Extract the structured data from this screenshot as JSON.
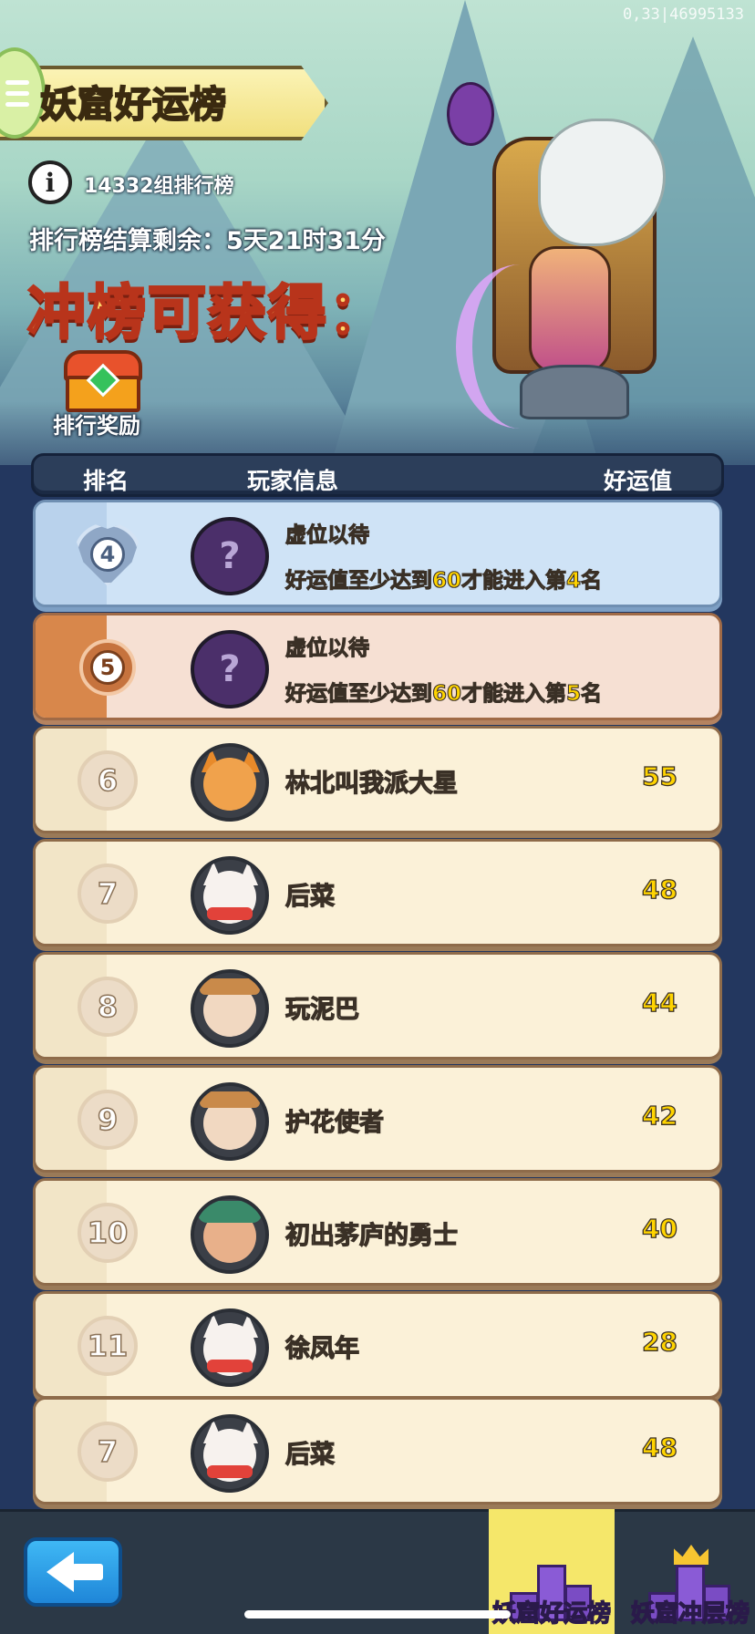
{
  "debug_id": "0,33|46995133",
  "header": {
    "title": "妖窟好运榜",
    "group_info": "14332组排行榜",
    "countdown": "排行榜结算剩余：5天21时31分",
    "reward_headline": "冲榜可获得：",
    "reward_label": "排行奖励"
  },
  "table": {
    "columns": [
      "排名",
      "玩家信息",
      "好运值"
    ],
    "placeholder_rows": [
      {
        "rank": "4",
        "name": "虚位以待",
        "hint_prefix": "好运值至少达到",
        "hint_score": "60",
        "hint_mid": "才能进入第",
        "hint_rank": "4",
        "hint_suffix": "名"
      },
      {
        "rank": "5",
        "name": "虚位以待",
        "hint_prefix": "好运值至少达到",
        "hint_score": "60",
        "hint_mid": "才能进入第",
        "hint_rank": "5",
        "hint_suffix": "名"
      }
    ],
    "rows": [
      {
        "rank": "6",
        "name": "林北叫我派大星",
        "score": "55",
        "avatar": "corgi"
      },
      {
        "rank": "7",
        "name": "后菜",
        "score": "48",
        "avatar": "lucky-cat"
      },
      {
        "rank": "8",
        "name": "玩泥巴",
        "score": "44",
        "avatar": "warrior"
      },
      {
        "rank": "9",
        "name": "护花使者",
        "score": "42",
        "avatar": "warrior"
      },
      {
        "rank": "10",
        "name": "初出茅庐的勇士",
        "score": "40",
        "avatar": "dragon"
      },
      {
        "rank": "11",
        "name": "徐凤年",
        "score": "28",
        "avatar": "lucky-cat"
      },
      {
        "rank": "7",
        "name": "后菜",
        "score": "48",
        "avatar": "lucky-cat"
      }
    ]
  },
  "nav": {
    "tab_active": "妖窟好运榜",
    "tab_second": "妖窟冲层榜"
  },
  "colors": {
    "score_yellow": "#ffd400",
    "active_tab": "#f5e76a",
    "panel_bg": "#23375f"
  }
}
